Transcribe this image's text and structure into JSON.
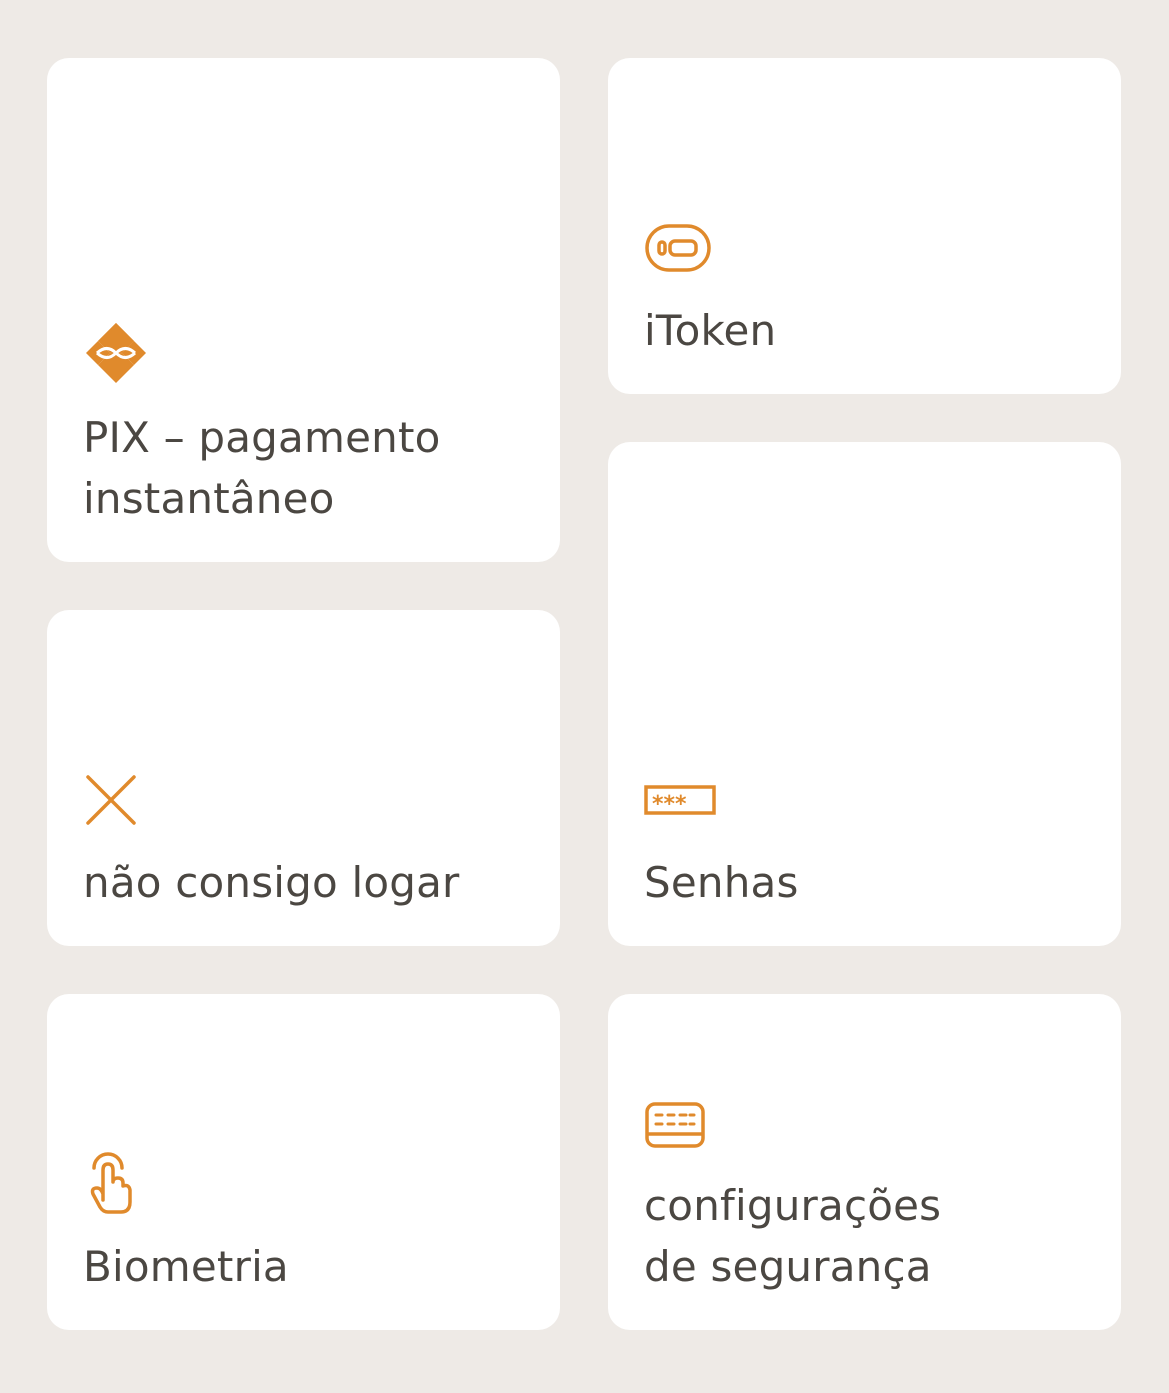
{
  "accent_color": "#e08a2c",
  "text_color": "#4b4742",
  "background_color": "#eeeae6",
  "cards": [
    {
      "label": "PIX – pagamento\ninstantâneo",
      "icon": "pix-icon"
    },
    {
      "label": "iToken",
      "icon": "token-icon"
    },
    {
      "label": "não consigo logar",
      "icon": "close-x-icon"
    },
    {
      "label": "Senhas",
      "icon": "password-icon"
    },
    {
      "label": "Biometria",
      "icon": "fingerprint-touch-icon"
    },
    {
      "label": "configurações\nde segurança",
      "icon": "keyboard-settings-icon"
    }
  ]
}
